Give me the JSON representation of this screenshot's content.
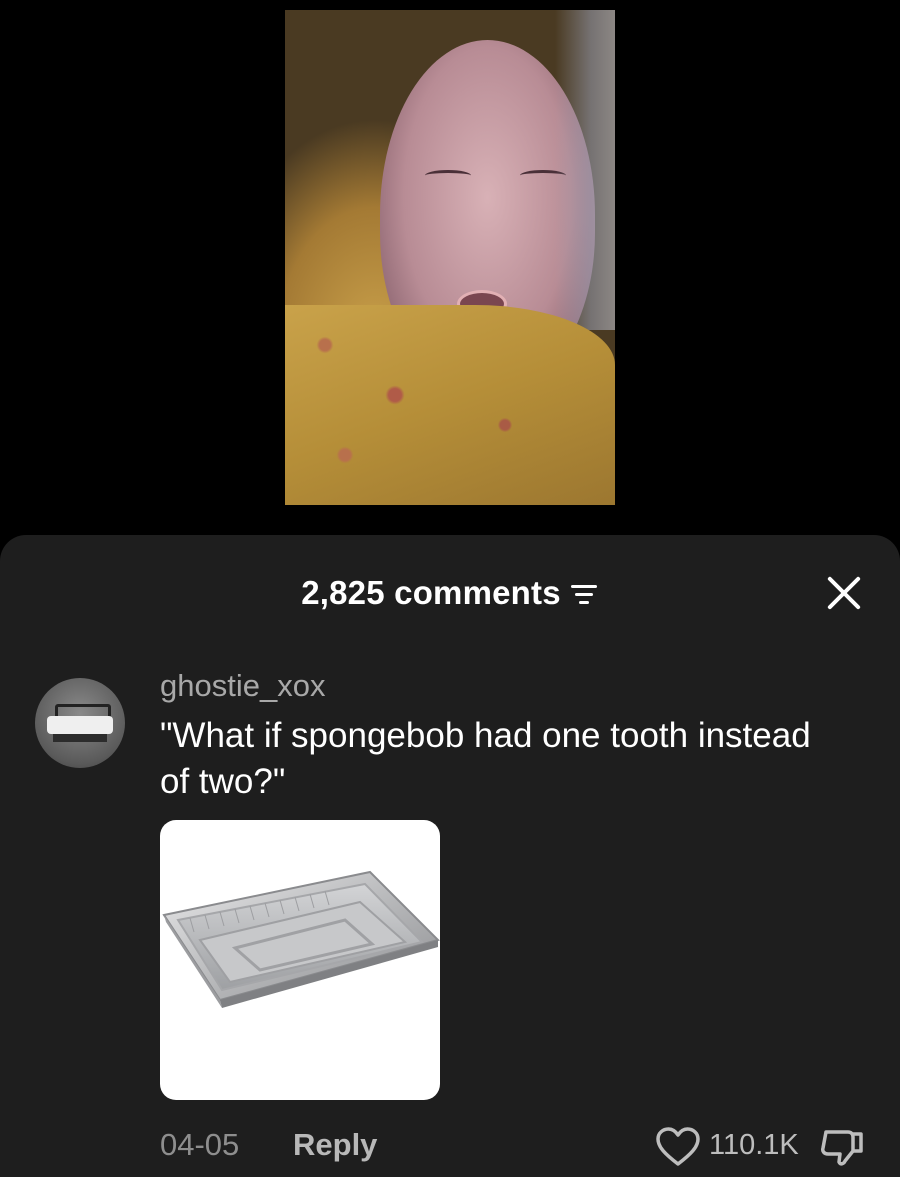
{
  "video": {
    "icon": "video-frame"
  },
  "comments_sheet": {
    "count_label": "2,825 comments",
    "sort_icon": "sort-lines-icon",
    "close_icon": "close-icon"
  },
  "comment": {
    "username": "ghostie_xox",
    "text": "\"What if spongebob had one tooth instead of two?\"",
    "image_icon": "aluminum-tray-image",
    "date": "04-05",
    "reply_label": "Reply",
    "like_count": "110.1K",
    "like_icon": "heart-outline-icon",
    "dislike_icon": "thumbs-down-icon"
  },
  "colors": {
    "sheet_bg": "#1e1e1e",
    "username": "#a8a8a8",
    "meta": "#8e8e8e"
  }
}
